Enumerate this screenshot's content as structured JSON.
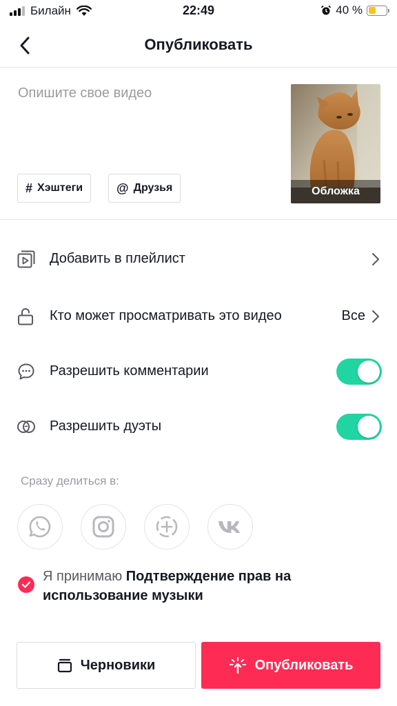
{
  "status_bar": {
    "carrier": "Билайн",
    "time": "22:49",
    "battery": "40 %",
    "battery_level": 0.4
  },
  "header": {
    "title": "Опубликовать"
  },
  "post": {
    "description_placeholder": "Опишите свое видео",
    "hashtags_label": "Хэштеги",
    "friends_label": "Друзья",
    "cover_label": "Обложка"
  },
  "settings": {
    "playlist_label": "Добавить в плейлист",
    "visibility_label": "Кто может просматривать это видео",
    "visibility_value": "Все",
    "comments_label": "Разрешить комментарии",
    "comments_enabled": true,
    "duets_label": "Разрешить дуэты",
    "duets_enabled": true
  },
  "share": {
    "label": "Сразу делиться в:",
    "targets": [
      "whatsapp-icon",
      "instagram-icon",
      "add-story-icon",
      "vk-icon"
    ]
  },
  "consent": {
    "prefix": "Я принимаю",
    "link": "Подтверждение прав на использование музыки",
    "checked": true
  },
  "actions": {
    "drafts_label": "Черновики",
    "publish_label": "Опубликовать"
  },
  "colors": {
    "accent": "#fe2c55",
    "toggle_on": "#20d5a1",
    "muted_text": "#9a9ba1"
  }
}
